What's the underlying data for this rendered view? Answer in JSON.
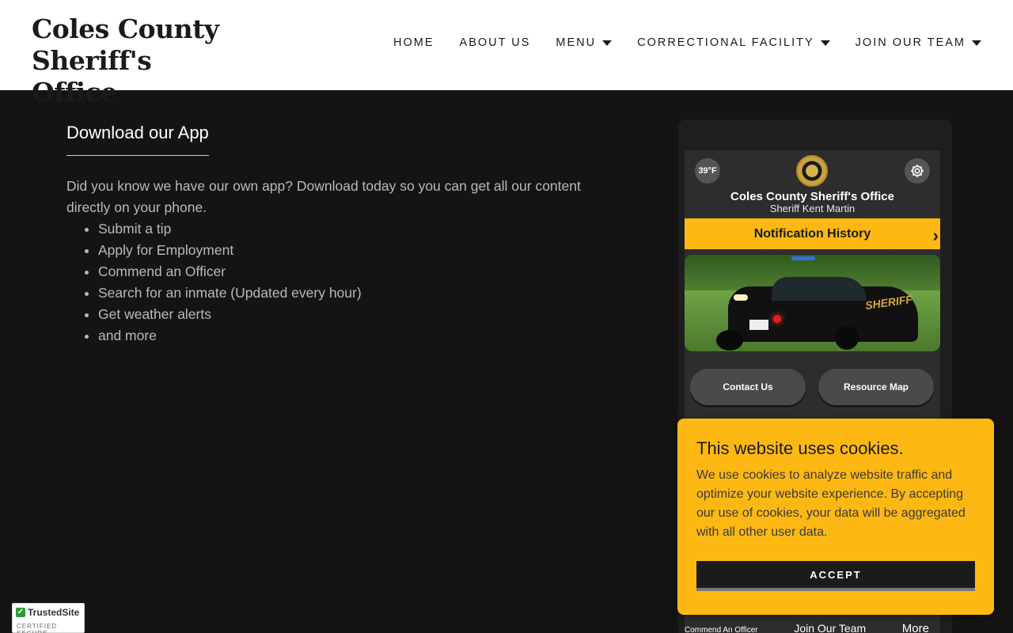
{
  "header": {
    "brand_line1": "Coles County",
    "brand_line2": "Sheriff's Office",
    "nav": [
      {
        "label": "HOME",
        "dropdown": false
      },
      {
        "label": "ABOUT US",
        "dropdown": false
      },
      {
        "label": "MENU",
        "dropdown": true
      },
      {
        "label": "CORRECTIONAL FACILITY",
        "dropdown": true
      },
      {
        "label": "JOIN OUR TEAM",
        "dropdown": true
      }
    ]
  },
  "main": {
    "title": "Download our App",
    "intro": "Did you know we have our own app? Download today so you can get all our content directly on your phone.",
    "features": [
      "Submit a tip",
      "Apply for Employment",
      "Commend an Officer",
      "Search for an inmate (Updated every hour)",
      "Get weather alerts",
      "and more"
    ]
  },
  "phone": {
    "temperature": "39°F",
    "app_name": "Coles County Sheriff's Office",
    "app_subtitle": "Sheriff Kent Martin",
    "notification_label": "Notification History",
    "vehicle_text": "SHERIFF",
    "buttons": {
      "contact": "Contact Us",
      "resource_map": "Resource Map"
    },
    "bottom": {
      "commend": "Commend An Officer",
      "join": "Join Our Team",
      "more": "More"
    }
  },
  "cookie": {
    "title": "This website uses cookies.",
    "text": "We use cookies to analyze website traffic and optimize your website experience. By accepting our use of cookies, your data will be aggregated with all other user data.",
    "accept_label": "ACCEPT"
  },
  "trust_badge": {
    "name": "TrustedSite",
    "caption": "CERTIFIED SECURE"
  },
  "colors": {
    "accent": "#fdb813",
    "background": "#141414",
    "header_bg": "#ffffff"
  }
}
